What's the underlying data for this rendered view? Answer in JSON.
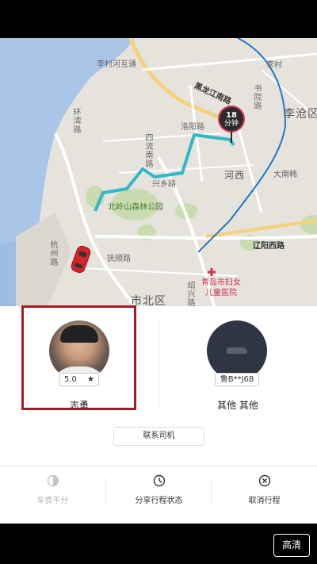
{
  "map": {
    "labels": {
      "li_cun_he_interchange": "李村河互通",
      "huan_wan_lu": "环湾路",
      "hei_long_jiang_nan_lu": "黑龙江南路",
      "li_cang_district": "李沧区",
      "li_cun": "李村",
      "jie_yang_lu": "洛阳路",
      "si_liu_nan_lu": "四流南路",
      "shi_kou_lu": "书院路",
      "he_xi": "河西",
      "da_nan_zhuang": "大南韩",
      "bei_ling_shan_park": "北岭山森林公园",
      "xing_xiang_lu": "兴乡路",
      "liao_yang_xi_lu": "辽阳西路",
      "hang_zhou_lu": "杭州路",
      "fu_shun_lu": "抚顺路",
      "shi_bei_district": "市北区",
      "shao_xing_lu": "绍兴路",
      "hospital": "青岛市妇女\n儿童医院"
    },
    "eta": {
      "number": "18",
      "unit": "分钟"
    }
  },
  "driver": {
    "rating": "5.0",
    "star": "★",
    "name": "志勇"
  },
  "vehicle": {
    "plate": "鲁B**J68",
    "description": "其他 其他"
  },
  "contact_button": "联系司机",
  "actions": {
    "fare_split": "车费平分",
    "share_trip": "分享行程状态",
    "cancel_trip": "取消行程"
  },
  "hd_button": "高清",
  "colors": {
    "route": "#31b8c7",
    "highlight_border": "#a8191d",
    "eta_ring": "#d6355a",
    "car": "#d8232a",
    "water": "#a9c6e8"
  }
}
